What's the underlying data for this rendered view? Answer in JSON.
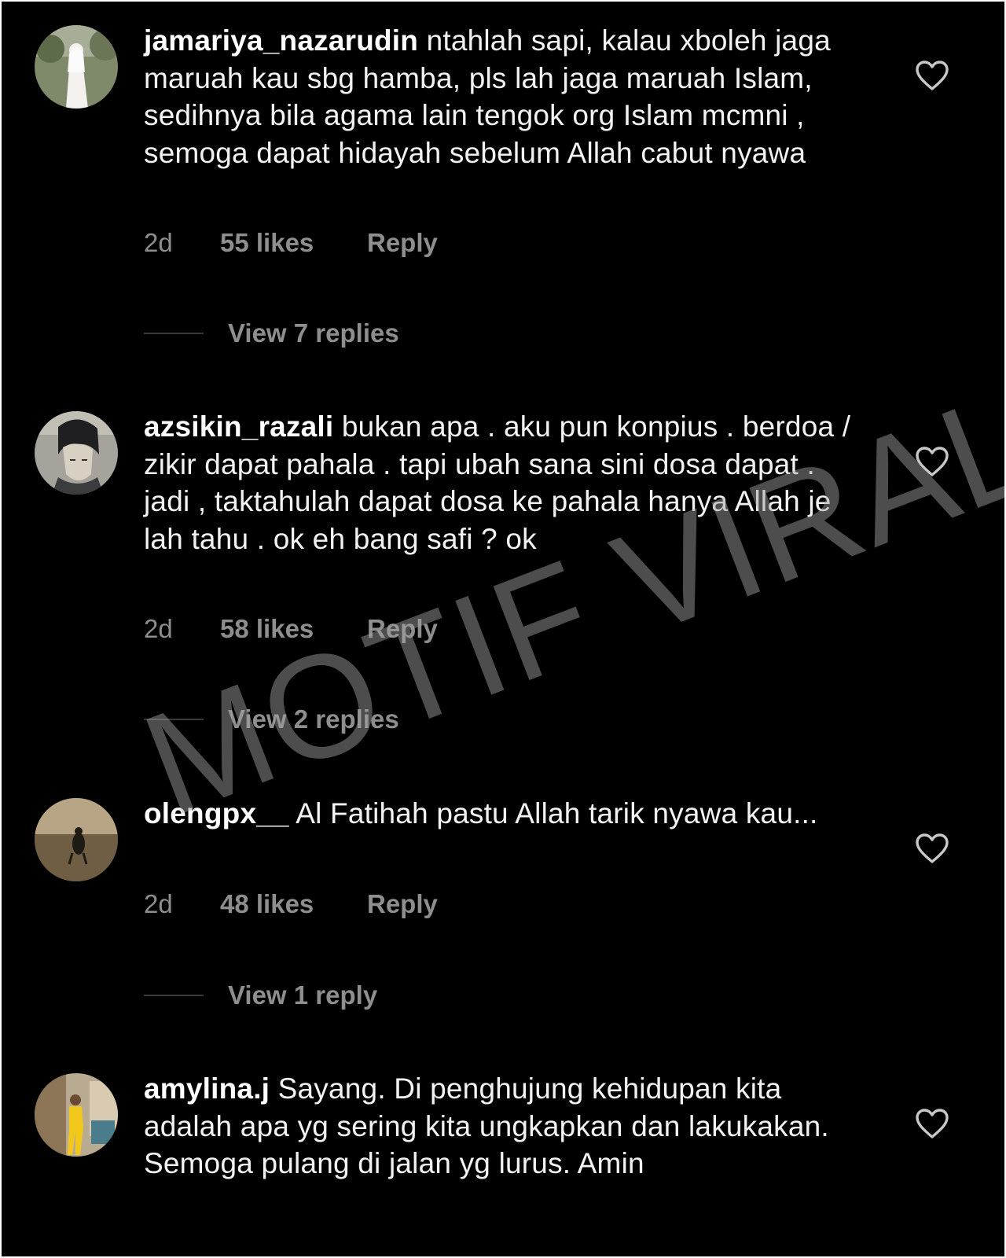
{
  "comments": [
    {
      "username": "jamariya_nazarudin",
      "text": "ntahlah sapi, kalau xboleh jaga maruah kau sbg hamba, pls lah jaga maruah Islam, sedihnya bila agama lain tengok org Islam mcmni , semoga dapat hidayah sebelum Allah cabut nyawa",
      "time": "2d",
      "likes": "55 likes",
      "reply_label": "Reply",
      "view_replies": "View 7 replies",
      "avatar_icon": "profile-photo"
    },
    {
      "username": "azsikin_razali",
      "text": "bukan apa . aku pun konpius . berdoa / zikir dapat pahala . tapi ubah sana sini dosa dapat . jadi , taktahulah dapat dosa ke pahala hanya Allah je lah tahu . ok eh bang safi ? ok",
      "time": "2d",
      "likes": "58 likes",
      "reply_label": "Reply",
      "view_replies": "View 2 replies",
      "avatar_icon": "profile-photo"
    },
    {
      "username": "olengpx__",
      "text": "Al Fatihah pastu Allah tarik nyawa kau...",
      "time": "2d",
      "likes": "48 likes",
      "reply_label": "Reply",
      "view_replies": "View 1 reply",
      "avatar_icon": "profile-photo"
    },
    {
      "username": "amylina.j",
      "text": "Sayang. Di penghujung kehidupan kita adalah apa yg sering kita ungkapkan dan lakukakan. Semoga pulang di jalan yg lurus. Amin",
      "avatar_icon": "profile-photo"
    }
  ],
  "watermark": "MOTIF VIRAL",
  "colors": {
    "background": "#000000",
    "text": "#f2f2f2",
    "muted": "#8e8e8e",
    "heart": "#c8c8c8"
  }
}
